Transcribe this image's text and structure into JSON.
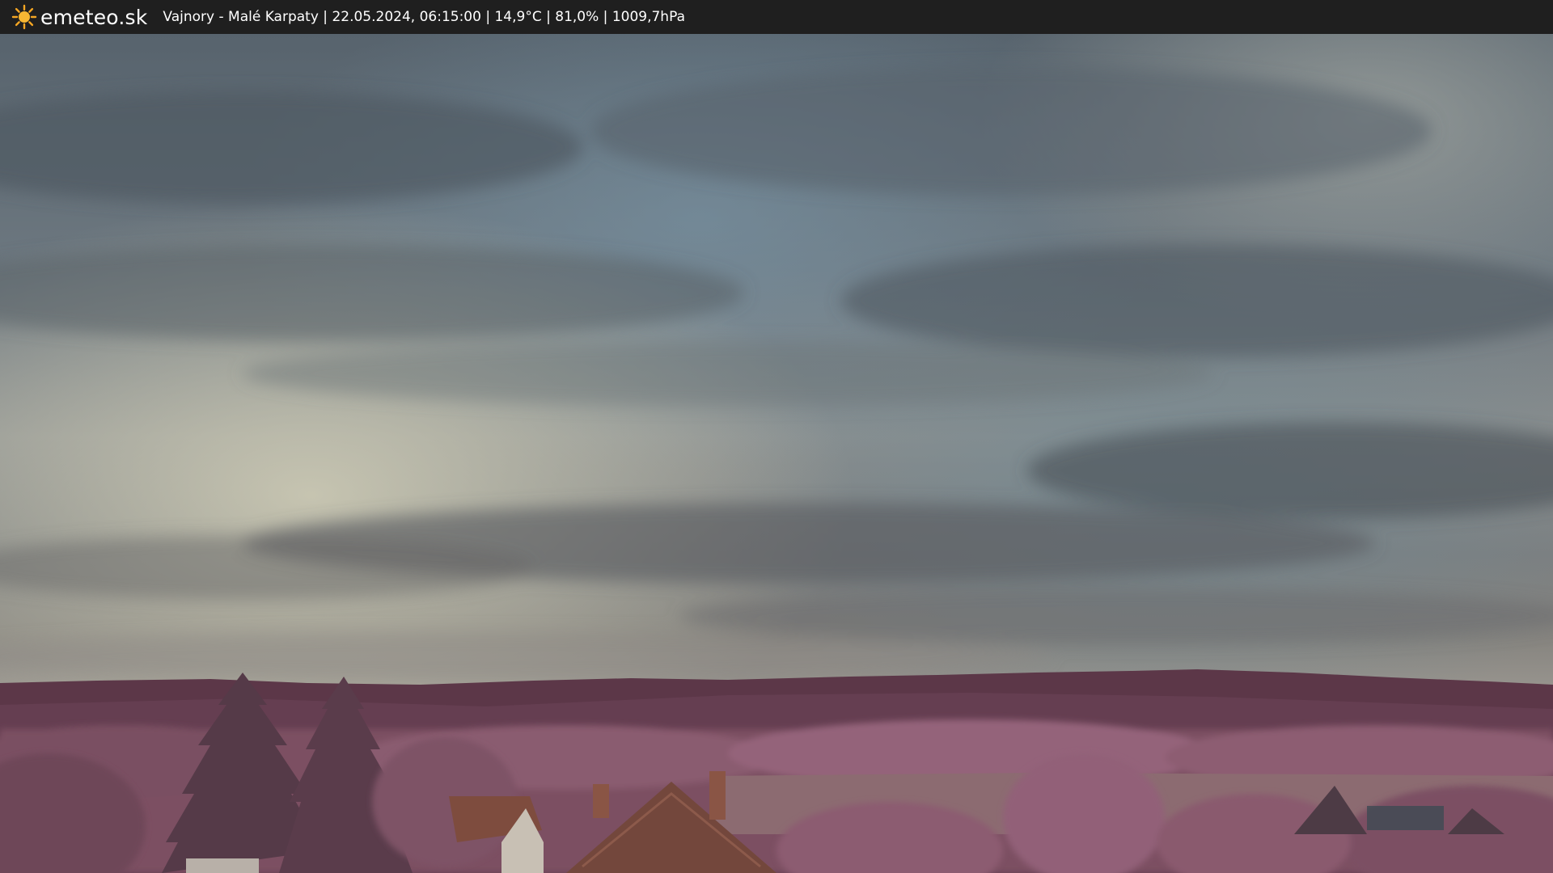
{
  "header": {
    "logo_icon": "sun-icon",
    "brand": "emeteo.sk",
    "location": "Vajnory - Malé Karpaty",
    "datetime": "22.05.2024, 06:15:00",
    "temperature": "14,9°C",
    "humidity": "81,0%",
    "pressure": "1009,7hPa",
    "separator": " | "
  },
  "colors": {
    "bar": "#1f1f1f",
    "sun": "#f5a623",
    "sky_top": "#5f6c76",
    "sky_haze": "#b7b6a9",
    "hills": "#5d3849",
    "foliage": "#8f5e72",
    "field": "#8a6a70",
    "roof": "#7c4b3d"
  }
}
